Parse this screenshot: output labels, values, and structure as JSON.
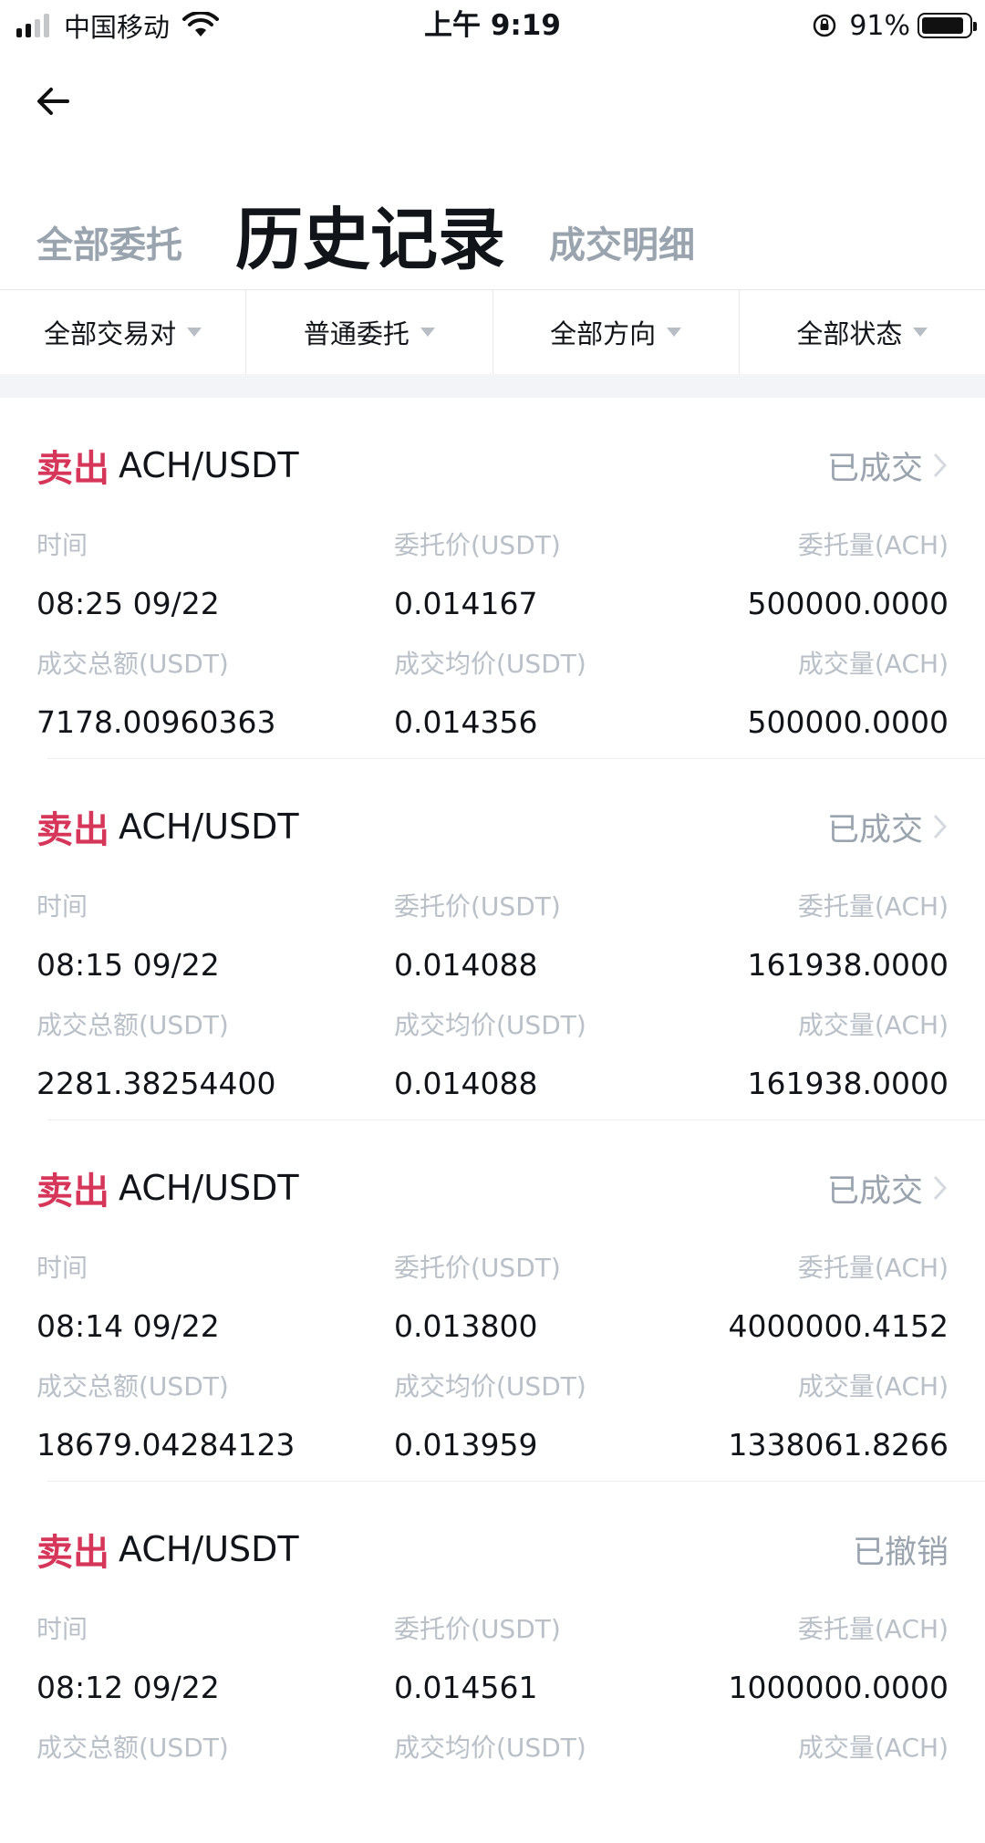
{
  "status_bar": {
    "carrier": "中国移动",
    "time": "上午 9:19",
    "battery": "91%",
    "battery_level": 0.91
  },
  "header": {
    "tabs": [
      {
        "label": "全部委托"
      },
      {
        "label": "历史记录"
      },
      {
        "label": "成交明细"
      }
    ]
  },
  "filters": [
    {
      "label": "全部交易对"
    },
    {
      "label": "普通委托"
    },
    {
      "label": "全部方向"
    },
    {
      "label": "全部状态"
    }
  ],
  "orders": [
    {
      "side": "卖出",
      "pair": "ACH/USDT",
      "status": "已成交",
      "labels": {
        "time": "时间",
        "price": "委托价(USDT)",
        "amount": "委托量(ACH)",
        "total": "成交总额(USDT)",
        "avg": "成交均价(USDT)",
        "filled": "成交量(ACH)"
      },
      "time": "08:25 09/22",
      "price": "0.014167",
      "amount": "500000.0000",
      "total": "7178.00960363",
      "avg": "0.014356",
      "filled": "500000.0000"
    },
    {
      "side": "卖出",
      "pair": "ACH/USDT",
      "status": "已成交",
      "labels": {
        "time": "时间",
        "price": "委托价(USDT)",
        "amount": "委托量(ACH)",
        "total": "成交总额(USDT)",
        "avg": "成交均价(USDT)",
        "filled": "成交量(ACH)"
      },
      "time": "08:15 09/22",
      "price": "0.014088",
      "amount": "161938.0000",
      "total": "2281.38254400",
      "avg": "0.014088",
      "filled": "161938.0000"
    },
    {
      "side": "卖出",
      "pair": "ACH/USDT",
      "status": "已成交",
      "labels": {
        "time": "时间",
        "price": "委托价(USDT)",
        "amount": "委托量(ACH)",
        "total": "成交总额(USDT)",
        "avg": "成交均价(USDT)",
        "filled": "成交量(ACH)"
      },
      "time": "08:14 09/22",
      "price": "0.013800",
      "amount": "4000000.4152",
      "total": "18679.04284123",
      "avg": "0.013959",
      "filled": "1338061.8266"
    },
    {
      "side": "卖出",
      "pair": "ACH/USDT",
      "status": "已撤销",
      "labels": {
        "time": "时间",
        "price": "委托价(USDT)",
        "amount": "委托量(ACH)",
        "total": "成交总额(USDT)",
        "avg": "成交均价(USDT)",
        "filled": "成交量(ACH)"
      },
      "time": "08:12 09/22",
      "price": "0.014561",
      "amount": "1000000.0000",
      "total": "",
      "avg": "",
      "filled": ""
    }
  ],
  "colors": {
    "sell": "#d6365a",
    "muted": "#9aa4ae",
    "label": "#b9c0c8",
    "text": "#111418"
  }
}
